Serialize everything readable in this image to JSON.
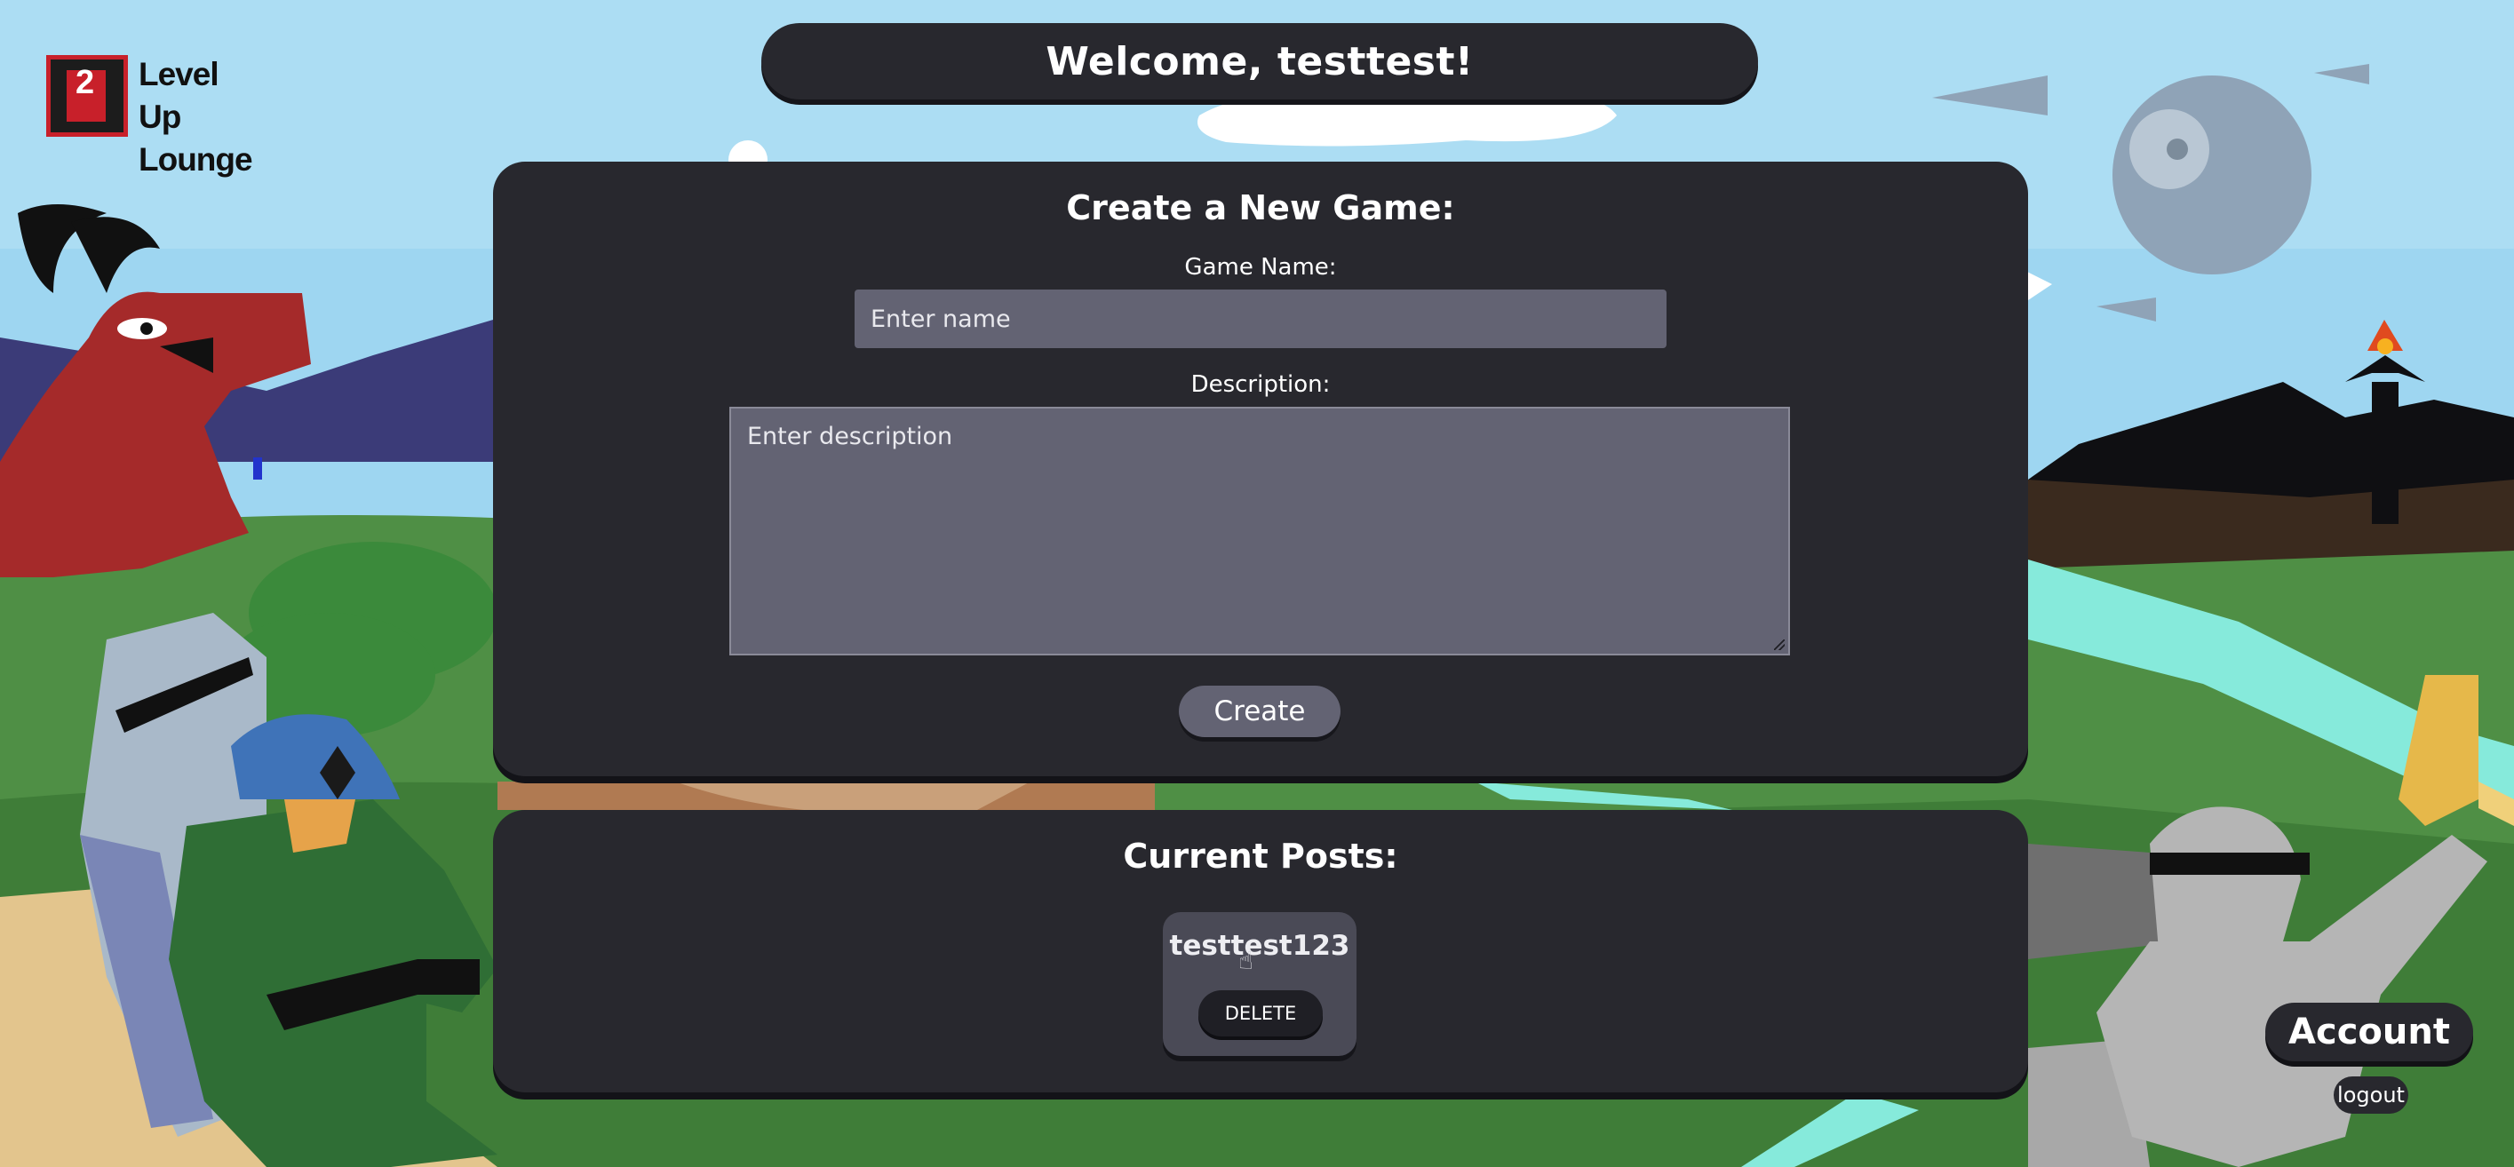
{
  "logo": {
    "number": "2",
    "text": "Level Up Lounge"
  },
  "header": {
    "welcome": "Welcome, testtest!"
  },
  "create_game": {
    "title": "Create a New Game:",
    "name_label": "Game Name:",
    "name_placeholder": "Enter name",
    "description_label": "Description:",
    "description_placeholder": "Enter description",
    "create_label": "Create"
  },
  "posts": {
    "title": "Current Posts:",
    "items": [
      {
        "title": "testtest123",
        "delete_label": "DELETE"
      }
    ]
  },
  "account": {
    "account_label": "Account",
    "logout_label": "logout"
  },
  "colors": {
    "panel": "#28282e",
    "input": "#636373",
    "sky": "#7ecbea",
    "grass": "#4f8f45"
  }
}
